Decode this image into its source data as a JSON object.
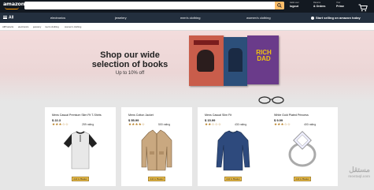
{
  "header": {
    "logo": "amazon",
    "search": {
      "placeholder": "",
      "value": ""
    },
    "account": {
      "small": "Hello user",
      "big": "logout"
    },
    "orders": {
      "small": "Returns",
      "big": "& Orders"
    },
    "prime": {
      "small": "Your",
      "big": "Prime"
    }
  },
  "nav": {
    "all_label": "All",
    "categories": [
      "electronics",
      "jewelery",
      "men's clothing",
      "women's clothing"
    ],
    "promo": "Start selling on amazon today"
  },
  "breadcrumbs": [
    "AllProducts",
    "electronics",
    "jewelery",
    "men's clothing",
    "women's clothing"
  ],
  "hero": {
    "headline": "Shop our wide selection of books",
    "subline": "Up to 10% off",
    "book_text": "RICH DAD"
  },
  "products": [
    {
      "title": "Mens Casual Premium Slim Fit T-Shirts",
      "price": "$ 22.3",
      "stars": "★★★☆☆",
      "rating": "259 rating",
      "button": "Add to Basket"
    },
    {
      "title": "Mens Cotton Jacket",
      "price": "$ 55.99",
      "stars": "★★★★☆",
      "rating": "500 rating",
      "button": "Add to Basket"
    },
    {
      "title": "Mens Casual Slim Fit",
      "price": "$ 15.99",
      "stars": "★★☆☆☆",
      "rating": "430 rating",
      "button": "Add to Basket"
    },
    {
      "title": "White Gold Plated Princess",
      "price": "$ 9.99",
      "stars": "★★★☆☆",
      "rating": "400 rating",
      "button": "Add to Basket"
    }
  ],
  "watermark": {
    "main": "مستقل",
    "sub": "mostaql.com"
  },
  "colors": {
    "header": "#131921",
    "navbar": "#232f3e",
    "accent": "#febd69",
    "button": "#f0c14b"
  }
}
